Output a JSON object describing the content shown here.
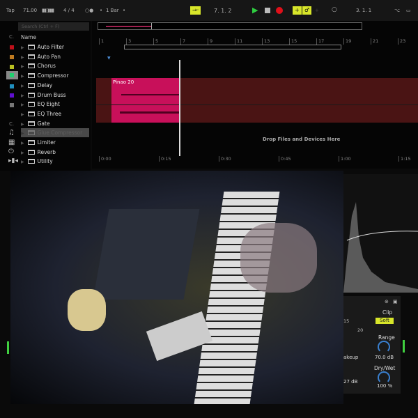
{
  "transport": {
    "tap": "Tap",
    "tempo": "71.00",
    "signature": "4 / 4",
    "quantize": "1 Bar",
    "position": "7.  1.  2",
    "loop_position": "3.  1.  1"
  },
  "browser": {
    "search_placeholder": "Search (Ctrl + F)",
    "col_c": "C.",
    "col_name": "Name",
    "colors": [
      "#c0101a",
      "#c07a20",
      "#b8c020",
      "#20d070",
      "#2090c0",
      "#6010d0",
      "#777777"
    ],
    "items": [
      "Auto Filter",
      "Auto Pan",
      "Chorus",
      "Compressor",
      "Delay",
      "Drum Buss",
      "EQ Eight",
      "EQ Three",
      "Gate",
      "Glue Compressor",
      "Limiter",
      "Reverb",
      "Utility"
    ],
    "dragging_item_index": 9
  },
  "arrangement": {
    "bar_ticks": [
      "1",
      "3",
      "5",
      "7",
      "9",
      "11",
      "13",
      "15",
      "17",
      "19",
      "21",
      "23"
    ],
    "clip_name": "Pinao 20",
    "drop_text": "Drop Files and Devices Here",
    "time_ticks": [
      "0:00",
      "0:15",
      "0:30",
      "0:45",
      "1:00",
      "1:15"
    ],
    "clip_color": "#c8105a",
    "track_color": "#4a1414"
  },
  "device": {
    "clip_label": "Clip",
    "clip_mode": "Soft",
    "range_label": "Range",
    "range_value": "70.0 dB",
    "drywet_label": "Dry/Wet",
    "drywet_value": "100 %",
    "makeup_label": "akeup",
    "makeup_value": "27 dB",
    "scale_15": "15",
    "scale_20": "20"
  },
  "colors": {
    "accent_yellow": "#d8e62a",
    "play_green": "#2ecc40",
    "record_red": "#e0101a"
  }
}
